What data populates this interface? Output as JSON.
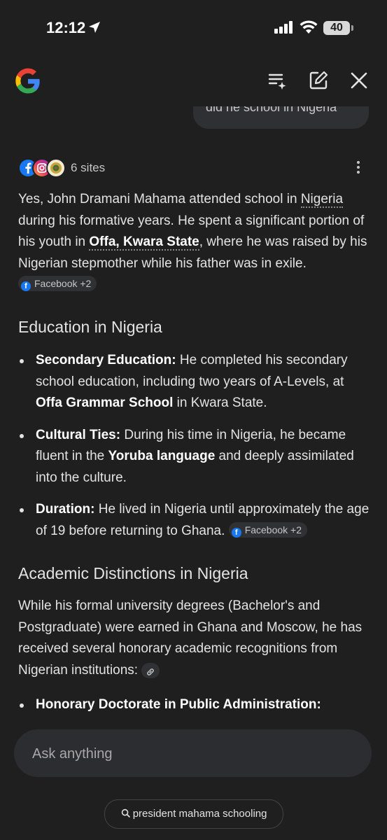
{
  "status": {
    "time": "12:12",
    "battery": "40"
  },
  "thread": {
    "user_query_partial": "did he school in Nigeria"
  },
  "sources": {
    "count_label": "6 sites"
  },
  "answer": {
    "intro_1": "Yes, John Dramani Mahama attended school in ",
    "intro_nigeria": "Nigeria",
    "intro_2": " during his formative years. He spent a significant portion of his youth in ",
    "intro_offa": "Offa, Kwara State",
    "intro_3": ", where he was raised by his Nigerian stepmother while his father was in exile. ",
    "chip": "Facebook +2"
  },
  "section1": {
    "heading": "Education in Nigeria",
    "items": [
      {
        "label": "Secondary Education:",
        "t1": " He completed his secondary school education, including two years of A-Levels, at ",
        "strong": "Offa Grammar School",
        "t2": " in Kwara State."
      },
      {
        "label": "Cultural Ties:",
        "t1": " During his time in Nigeria, he became fluent in the ",
        "strong": "Yoruba language",
        "t2": " and deeply assimilated into the culture."
      },
      {
        "label": "Duration:",
        "t1": " He lived in Nigeria until approximately the age of 19 before returning to Ghana. ",
        "chip": "Facebook +2"
      }
    ]
  },
  "section2": {
    "heading": "Academic Distinctions in Nigeria",
    "paragraph": "While his formal university degrees (Bachelor's and Postgraduate) were earned in Ghana and Moscow, he has received several honorary academic recognitions from Nigerian institutions: ",
    "items": [
      {
        "label": "Honorary Doctorate in Public Administration:"
      }
    ]
  },
  "input": {
    "placeholder": "Ask anything"
  },
  "suggestion": {
    "label": "president mahama schooling"
  },
  "colors": {
    "background": "#1f1f1f",
    "surface": "#2c2d30",
    "text": "#e3e3e3",
    "facebook": "#1877f2"
  }
}
